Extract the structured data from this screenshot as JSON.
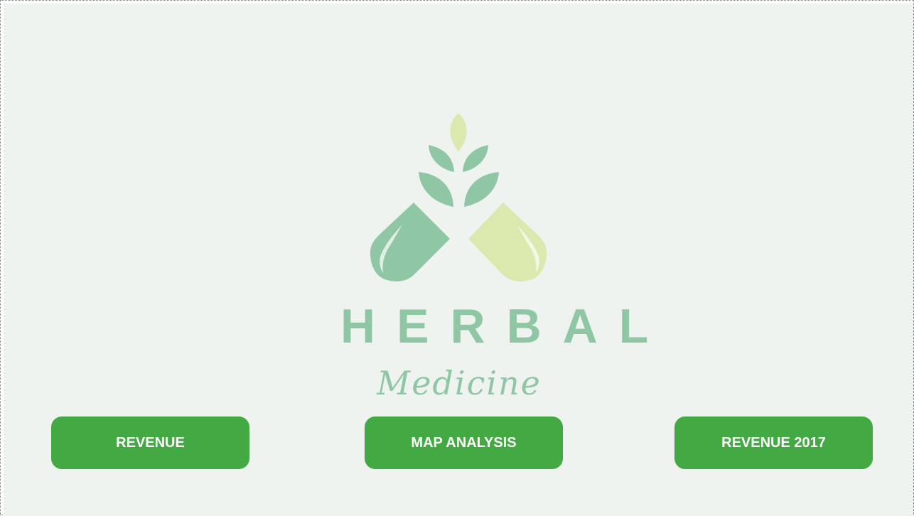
{
  "brand": {
    "word": "HERBAL",
    "subtitle": "Medicine",
    "logo_icon": "herbal-capsule-leaves-icon",
    "colors": {
      "dark_leaf": "#8fc7a5",
      "light_leaf": "#dae9ad",
      "background": "#eff3ef"
    }
  },
  "navigation": {
    "buttons": [
      {
        "label": "REVENUE"
      },
      {
        "label": "MAP ANALYSIS"
      },
      {
        "label": "REVENUE 2017"
      }
    ],
    "button_color": "#43a942",
    "button_text_color": "#ffffff"
  }
}
